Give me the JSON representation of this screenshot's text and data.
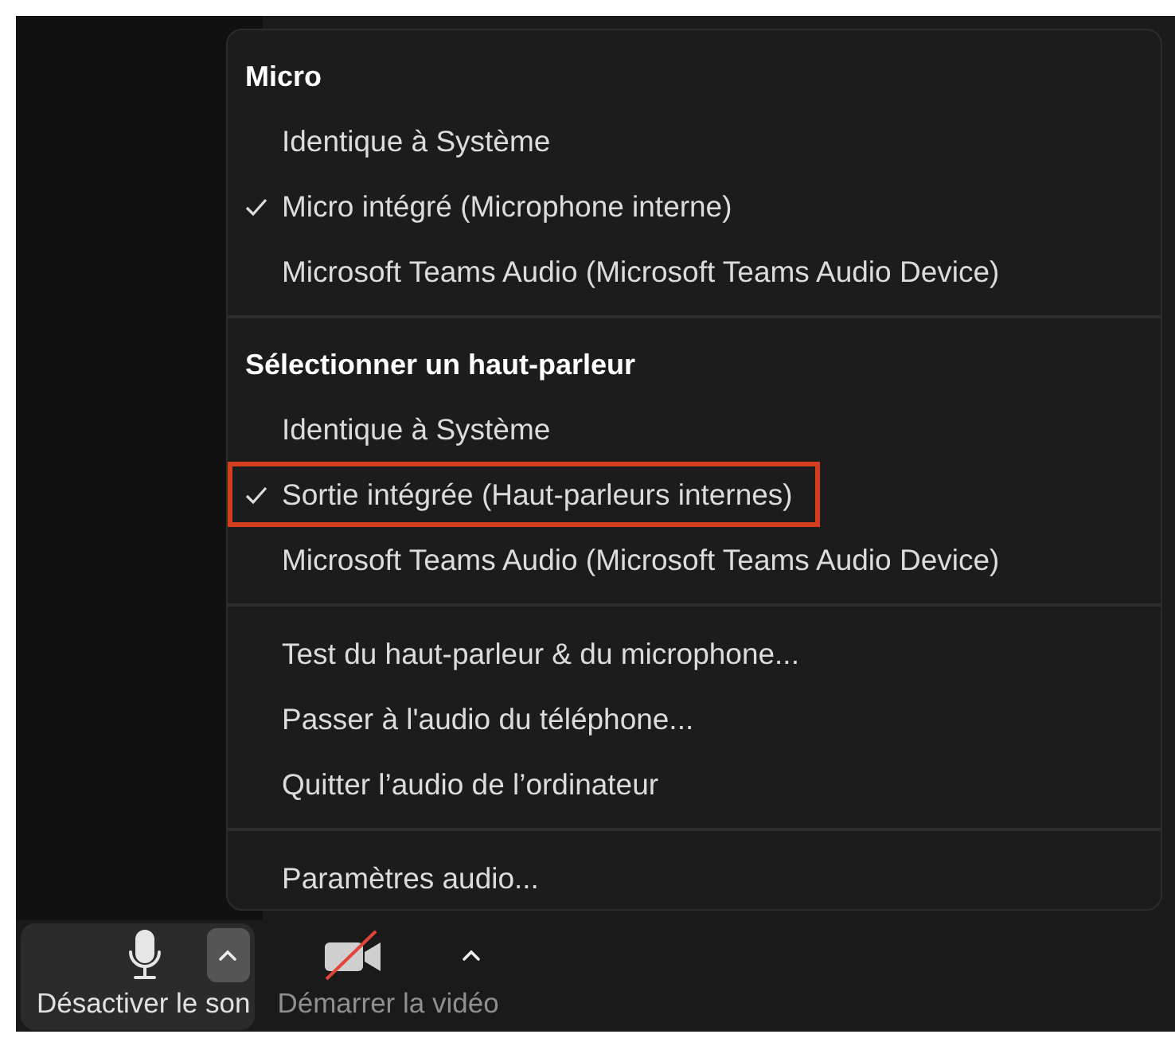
{
  "menu": {
    "sections": [
      {
        "heading": "Micro",
        "items": [
          {
            "label": "Identique à Système",
            "checked": false,
            "highlighted": false
          },
          {
            "label": "Micro intégré (Microphone interne)",
            "checked": true,
            "highlighted": false
          },
          {
            "label": "Microsoft Teams Audio (Microsoft Teams Audio Device)",
            "checked": false,
            "highlighted": false
          }
        ]
      },
      {
        "heading": "Sélectionner un haut-parleur",
        "items": [
          {
            "label": "Identique à Système",
            "checked": false,
            "highlighted": false
          },
          {
            "label": "Sortie intégrée (Haut-parleurs internes)",
            "checked": true,
            "highlighted": true
          },
          {
            "label": "Microsoft Teams Audio (Microsoft Teams Audio Device)",
            "checked": false,
            "highlighted": false
          }
        ]
      },
      {
        "items": [
          {
            "label": "Test du haut-parleur & du microphone...",
            "checked": false,
            "highlighted": false
          },
          {
            "label": "Passer à l'audio du téléphone...",
            "checked": false,
            "highlighted": false
          },
          {
            "label": "Quitter l’audio de l’ordinateur",
            "checked": false,
            "highlighted": false
          }
        ]
      },
      {
        "items": [
          {
            "label": "Paramètres audio...",
            "checked": false,
            "highlighted": false
          }
        ]
      }
    ]
  },
  "toolbar": {
    "buttons": [
      {
        "kind": "mic",
        "label": "Désactiver le son",
        "selected": true
      },
      {
        "kind": "video",
        "label": "Démarrer la vidéo",
        "selected": false
      }
    ]
  }
}
